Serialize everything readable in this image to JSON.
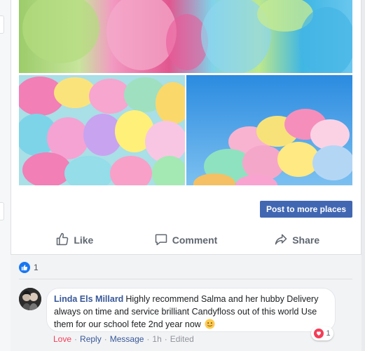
{
  "post": {
    "post_button_label": "Post to more places"
  },
  "action_bar": {
    "like_label": "Like",
    "comment_label": "Comment",
    "share_label": "Share"
  },
  "reactions": {
    "count": "1",
    "icon": "thumbs-up-icon",
    "color": "#1877f2"
  },
  "comment": {
    "author": "Linda Els Millard",
    "text": "Highly recommend Salma and her hubby Delivery always on time and service brilliant Candyfloss out of this world Use them for our school fete 2nd year now",
    "emoji": "smiling-face-icon",
    "reaction_count": "1",
    "reaction_icon": "heart-icon",
    "actions": {
      "love": "Love",
      "reply": "Reply",
      "message": "Message",
      "time": "1h",
      "edited": "Edited",
      "dot": "·"
    }
  },
  "colors": {
    "brand": "#4267b2",
    "link": "#385898",
    "love": "#f33e58"
  }
}
